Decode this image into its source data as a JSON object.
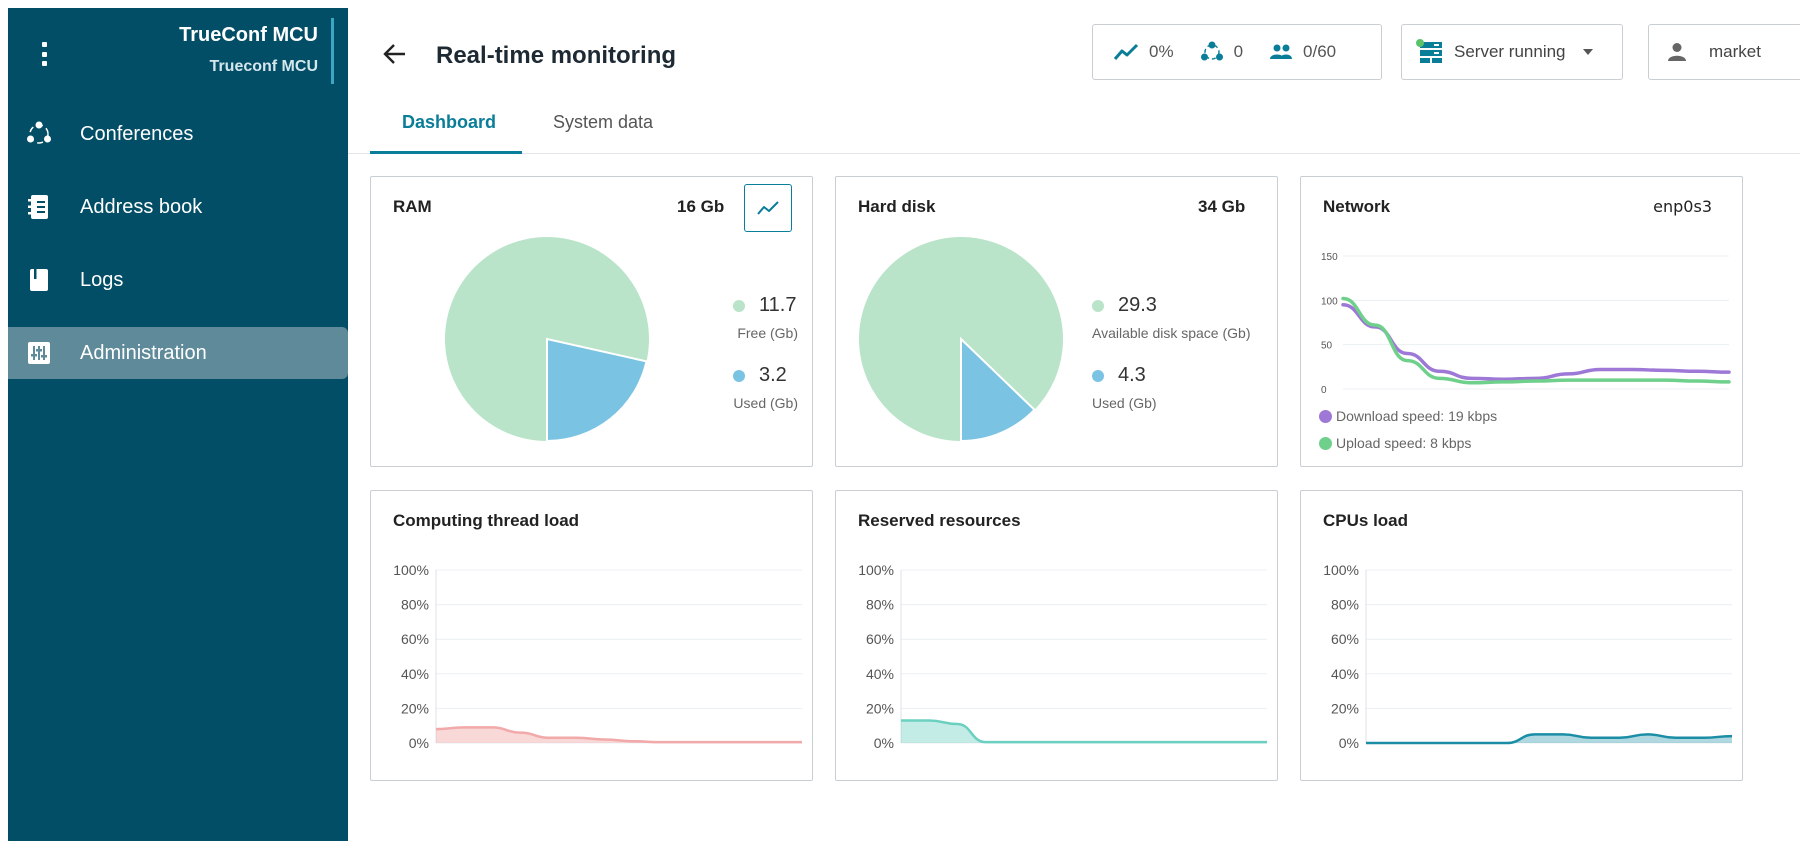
{
  "sidebar": {
    "brand_title": "TrueConf MCU",
    "brand_subtitle": "Trueconf MCU",
    "items": [
      {
        "label": "Conferences",
        "icon": "conferences-icon"
      },
      {
        "label": "Address book",
        "icon": "address-book-icon"
      },
      {
        "label": "Logs",
        "icon": "logs-icon"
      },
      {
        "label": "Administration",
        "icon": "administration-icon",
        "active": true
      }
    ],
    "background": "#024e66",
    "active_color": "#5e8a99"
  },
  "header": {
    "title": "Real-time monitoring",
    "stats": {
      "load": "0%",
      "conferences": "0",
      "participants": "0/60"
    },
    "server_status": "Server running",
    "user": "market",
    "accent": "#0a7d98"
  },
  "tabs": [
    {
      "label": "Dashboard",
      "active": true
    },
    {
      "label": "System data",
      "active": false
    }
  ],
  "cards": {
    "ram": {
      "title": "RAM",
      "total": "16 Gb",
      "free_value": "11.7",
      "free_caption": "Free (Gb)",
      "used_value": "3.2",
      "used_caption": "Used (Gb)"
    },
    "disk": {
      "title": "Hard disk",
      "total": "34 Gb",
      "free_value": "29.3",
      "free_caption": "Available disk space (Gb)",
      "used_value": "4.3",
      "used_caption": "Used (Gb)"
    },
    "network": {
      "title": "Network",
      "interface": "enp0s3",
      "download_label": "Download speed: 19 kbps",
      "upload_label": "Upload speed: 8 kbps"
    },
    "threads": {
      "title": "Computing thread load"
    },
    "reserved": {
      "title": "Reserved resources"
    },
    "cpus": {
      "title": "CPUs load"
    }
  },
  "colors": {
    "free": "#b9e4c9",
    "used": "#7ac3e3",
    "download": "#9d78d6",
    "upload": "#6fd08c",
    "threads": "#f2a9a9",
    "reserved": "#6bd0c0",
    "cpus": "#1b8ea6"
  },
  "chart_data": [
    {
      "id": "ram",
      "type": "pie",
      "categories": [
        "Free (Gb)",
        "Used (Gb)"
      ],
      "values": [
        11.7,
        3.2
      ]
    },
    {
      "id": "disk",
      "type": "pie",
      "categories": [
        "Available disk space (Gb)",
        "Used (Gb)"
      ],
      "values": [
        29.3,
        4.3
      ]
    },
    {
      "id": "network",
      "type": "line",
      "ylim": [
        0,
        150
      ],
      "yticks": [
        "0",
        "50",
        "100",
        "150"
      ],
      "series": [
        {
          "name": "Download speed: 19 kbps",
          "values": [
            95,
            70,
            40,
            20,
            12,
            11,
            12,
            17,
            22,
            22,
            21,
            20,
            19
          ]
        },
        {
          "name": "Upload speed: 8 kbps",
          "values": [
            102,
            72,
            32,
            12,
            7,
            8,
            9,
            10,
            10,
            10,
            10,
            9,
            8
          ]
        }
      ]
    },
    {
      "id": "threads",
      "type": "area",
      "ylim": [
        0,
        100
      ],
      "yticks": [
        "0%",
        "20%",
        "40%",
        "60%",
        "80%",
        "100%"
      ],
      "values": [
        8,
        9,
        9,
        6,
        3,
        3,
        2,
        1,
        0.5,
        0.5,
        0.5,
        0.5,
        0.5,
        0.5
      ]
    },
    {
      "id": "reserved",
      "type": "area",
      "ylim": [
        0,
        100
      ],
      "yticks": [
        "0%",
        "20%",
        "40%",
        "60%",
        "80%",
        "100%"
      ],
      "values": [
        13,
        13,
        11,
        0.5,
        0.5,
        0.5,
        0.5,
        0.5,
        0.5,
        0.5,
        0.5,
        0.5,
        0.5,
        0.5
      ]
    },
    {
      "id": "cpus",
      "type": "area",
      "ylim": [
        0,
        100
      ],
      "yticks": [
        "0%",
        "20%",
        "40%",
        "60%",
        "80%",
        "100%"
      ],
      "values": [
        0,
        0,
        0,
        0,
        0,
        0,
        5,
        5,
        3,
        3,
        5,
        3,
        3,
        4
      ]
    }
  ]
}
